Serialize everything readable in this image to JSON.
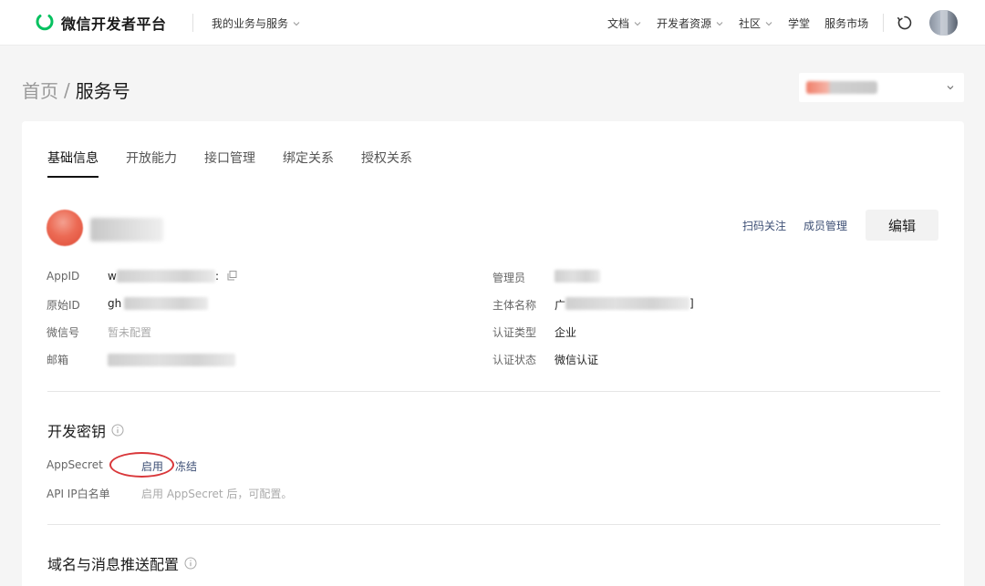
{
  "header": {
    "logo_text": "微信开发者平台",
    "biz_menu": "我的业务与服务",
    "nav": [
      "文档",
      "开发者资源",
      "社区",
      "学堂",
      "服务市场"
    ],
    "brand_color": "#07c160"
  },
  "breadcrumb": {
    "home": "首页",
    "sep": "/",
    "current": "服务号"
  },
  "tabs": [
    "基础信息",
    "开放能力",
    "接口管理",
    "绑定关系",
    "授权关系"
  ],
  "account": {
    "actions": {
      "scan_follow": "扫码关注",
      "members": "成员管理",
      "edit": "编辑"
    }
  },
  "info": {
    "appid": {
      "label": "AppID",
      "prefix": "w",
      "suffix": ":"
    },
    "original_id": {
      "label": "原始ID",
      "prefix": "gh"
    },
    "wechat_id": {
      "label": "微信号",
      "value": "暂未配置"
    },
    "email": {
      "label": "邮箱"
    },
    "admin": {
      "label": "管理员"
    },
    "entity": {
      "label": "主体名称",
      "prefix": "广",
      "suffix": "]"
    },
    "cert_type": {
      "label": "认证类型",
      "value": "企业"
    },
    "cert_status": {
      "label": "认证状态",
      "value": "微信认证"
    }
  },
  "dev_key": {
    "title": "开发密钥",
    "appsecret_label": "AppSecret",
    "enable": "启用",
    "freeze": "冻结",
    "ip_whitelist_label": "API IP白名单",
    "ip_whitelist_hint": "启用 AppSecret 后，可配置。"
  },
  "domain_section": {
    "title": "域名与消息推送配置"
  },
  "colors": {
    "link": "#3d4f75",
    "annotation": "#d9373a"
  }
}
